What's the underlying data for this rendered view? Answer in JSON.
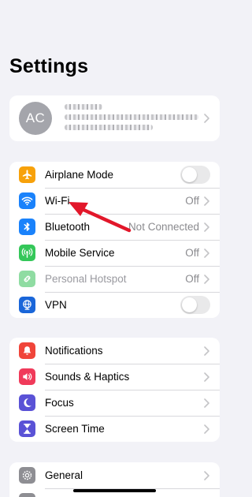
{
  "page": {
    "title": "Settings"
  },
  "profile": {
    "initials": "AC",
    "avatar_color": "#a4a5ab"
  },
  "connectivity": [
    {
      "label": "Airplane Mode",
      "icon": "airplane-icon",
      "color": "#f7a10a",
      "control": "toggle",
      "on": false
    },
    {
      "label": "Wi-Fi",
      "icon": "wifi-icon",
      "color": "#1a82fb",
      "control": "value",
      "value": "Off"
    },
    {
      "label": "Bluetooth",
      "icon": "bluetooth-icon",
      "color": "#1a82fb",
      "control": "value",
      "value": "Not Connected"
    },
    {
      "label": "Mobile Service",
      "icon": "antenna-icon",
      "color": "#34c759",
      "control": "value",
      "value": "Off"
    },
    {
      "label": "Personal Hotspot",
      "icon": "hotspot-icon",
      "color": "#8fdca2",
      "control": "value",
      "value": "Off",
      "disabled": true
    },
    {
      "label": "VPN",
      "icon": "globe-icon",
      "color": "#1a66d9",
      "control": "toggle",
      "on": false
    }
  ],
  "notifications_group": [
    {
      "label": "Notifications",
      "icon": "bell-icon",
      "color": "#f0453a"
    },
    {
      "label": "Sounds & Haptics",
      "icon": "speaker-icon",
      "color": "#f03a5a"
    },
    {
      "label": "Focus",
      "icon": "moon-icon",
      "color": "#5a52d6"
    },
    {
      "label": "Screen Time",
      "icon": "hourglass-icon",
      "color": "#5a52d6"
    }
  ],
  "general_group": [
    {
      "label": "General",
      "icon": "gear-icon",
      "color": "#8e8e93"
    }
  ],
  "annotation": {
    "arrow_color": "#e2172a"
  }
}
